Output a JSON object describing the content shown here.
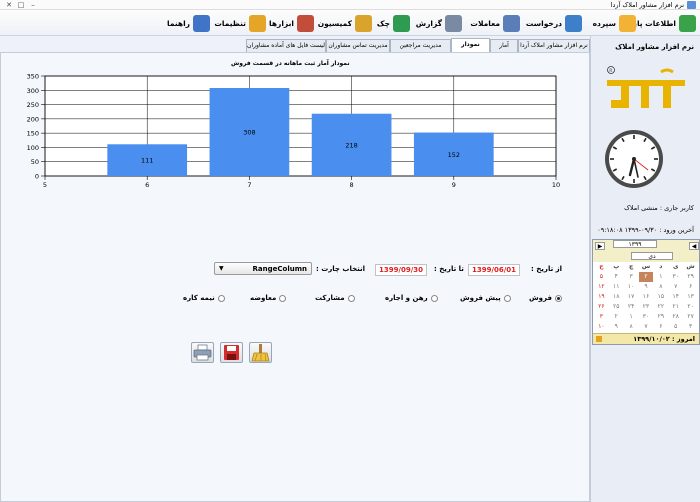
{
  "window": {
    "title": "نرم افزار مشاور املاک آردا",
    "controls": [
      "–",
      "□",
      "✕"
    ]
  },
  "toolbar": {
    "items": [
      {
        "label": "اطلاعات پایه",
        "icon": "folder-add-icon",
        "color": "#3aa34a"
      },
      {
        "label": "سپرده",
        "icon": "folder-icon",
        "color": "#f2b233"
      },
      {
        "label": "درخواست",
        "icon": "form-edit-icon",
        "color": "#3e7fc9"
      },
      {
        "label": "معاملات",
        "icon": "document-pen-icon",
        "color": "#5b7db8"
      },
      {
        "label": "گزارش",
        "icon": "magnifier-icon",
        "color": "#7a8aa3"
      },
      {
        "label": "چک",
        "icon": "check-cheque-icon",
        "color": "#2e9a52"
      },
      {
        "label": "کمیسیون",
        "icon": "money-bag-icon",
        "color": "#d9a32c"
      },
      {
        "label": "ابزارها",
        "icon": "tools-icon",
        "color": "#c24d3b"
      },
      {
        "label": "تنظیمات",
        "icon": "gear-icon",
        "color": "#e5a628"
      },
      {
        "label": "راهنما",
        "icon": "help-icon",
        "color": "#3f74c7"
      }
    ]
  },
  "tabs": [
    {
      "label": "نرم افزار مشاور املاک آردا",
      "active": false
    },
    {
      "label": "آمار",
      "active": false
    },
    {
      "label": "نمودار",
      "active": true
    },
    {
      "label": "مدیریت مراجعین",
      "active": false
    },
    {
      "label": "مدیریت تماس مشاوران",
      "active": false
    },
    {
      "label": "لیست فایل های آماده مشاوران",
      "active": false
    }
  ],
  "chart_data": {
    "type": "bar",
    "title": "نمودار آمار ثبت ماهانه در قسمت فروش",
    "x": [
      6,
      7,
      8,
      9
    ],
    "values": [
      111,
      308,
      218,
      152
    ],
    "xlim": [
      5,
      10
    ],
    "ylim": [
      0,
      350
    ],
    "yticks": [
      0,
      50,
      100,
      150,
      200,
      250,
      300,
      350
    ],
    "xticks": [
      5,
      6,
      7,
      8,
      9,
      10
    ],
    "grid": true,
    "bar_color": "#4a8ff0",
    "xlabel": "",
    "ylabel": ""
  },
  "filters": {
    "from_label": "از تاریخ :",
    "from_date": "1399/06/01",
    "to_label": "تا تاریخ :",
    "to_date": "1399/09/30",
    "chart_select_label": "انتخاب چارت :",
    "chart_select_value": "RangeColumn",
    "radios": [
      {
        "label": "فروش",
        "checked": true
      },
      {
        "label": "پیش فروش",
        "checked": false
      },
      {
        "label": "رهن و اجاره",
        "checked": false
      },
      {
        "label": "مشارکت",
        "checked": false
      },
      {
        "label": "معاوضه",
        "checked": false
      },
      {
        "label": "نیمه کاره",
        "checked": false
      }
    ],
    "buttons": [
      {
        "icon": "broom-clear-icon"
      },
      {
        "icon": "save-icon"
      },
      {
        "icon": "printer-icon"
      }
    ]
  },
  "sidebar": {
    "title": "نرم افزار مشاور املاک",
    "logo_text": "آردا",
    "logo_color": "#e8b400",
    "current_user": "کاربر جاری : منشی املاک",
    "last_login": "آخرین ورود : ۰۹/۳۰-۱۳۹۹ ۰۹:۱۸:۰۸",
    "calendar": {
      "month": "دی",
      "year": "۱۳۹۹",
      "weekdays": [
        "ش",
        "ی",
        "د",
        "س",
        "چ",
        "پ",
        "ج"
      ],
      "rows": [
        [
          "۲۹",
          "۳۰",
          "۱",
          "۲",
          "۳",
          "۴",
          "۵"
        ],
        [
          "۶",
          "۷",
          "۸",
          "۹",
          "۱۰",
          "۱۱",
          "۱۲"
        ],
        [
          "۱۳",
          "۱۴",
          "۱۵",
          "۱۶",
          "۱۷",
          "۱۸",
          "۱۹"
        ],
        [
          "۲۰",
          "۲۱",
          "۲۲",
          "۲۳",
          "۲۴",
          "۲۵",
          "۲۶"
        ],
        [
          "۲۷",
          "۲۸",
          "۲۹",
          "۳۰",
          "۱",
          "۲",
          "۳"
        ],
        [
          "۴",
          "۵",
          "۶",
          "۷",
          "۸",
          "۹",
          "۱۰"
        ]
      ],
      "today": "۲",
      "today_label": "امروز : ۱۳۹۹/۱۰/۰۲"
    }
  }
}
